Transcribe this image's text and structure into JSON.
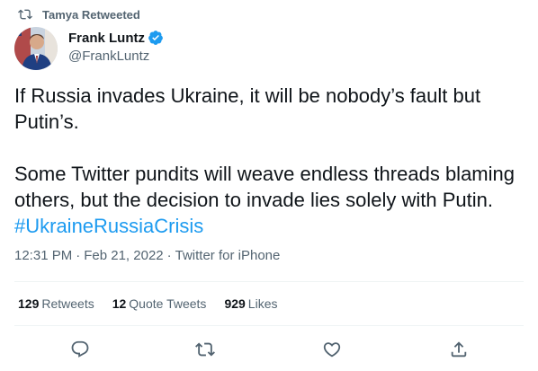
{
  "retweet_context": {
    "text": "Tamya Retweeted",
    "icon": "retweet-icon"
  },
  "author": {
    "display_name": "Frank Luntz",
    "handle": "@FrankLuntz",
    "verified_icon": "verified-badge-icon",
    "avatar": "avatar"
  },
  "tweet": {
    "paragraph1": "If Russia invades Ukraine, it will be nobody’s fault but Putin’s.",
    "paragraph2": "Some Twitter pundits will weave endless threads blaming others, but the decision to invade lies solely with Putin.",
    "hashtag": "#UkraineRussiaCrisis"
  },
  "meta": {
    "time": "12:31 PM",
    "separator": "·",
    "date": "Feb 21, 2022",
    "source": "Twitter for iPhone"
  },
  "stats": {
    "retweets_count": "129",
    "retweets_label": "Retweets",
    "quote_count": "12",
    "quote_label": "Quote Tweets",
    "likes_count": "929",
    "likes_label": "Likes"
  },
  "actions": [
    "reply-icon",
    "retweet-icon",
    "like-icon",
    "share-icon"
  ],
  "colors": {
    "link": "#1d9bf0",
    "secondary_text": "#536471",
    "primary_text": "#0f1419",
    "divider": "#eff3f4"
  }
}
